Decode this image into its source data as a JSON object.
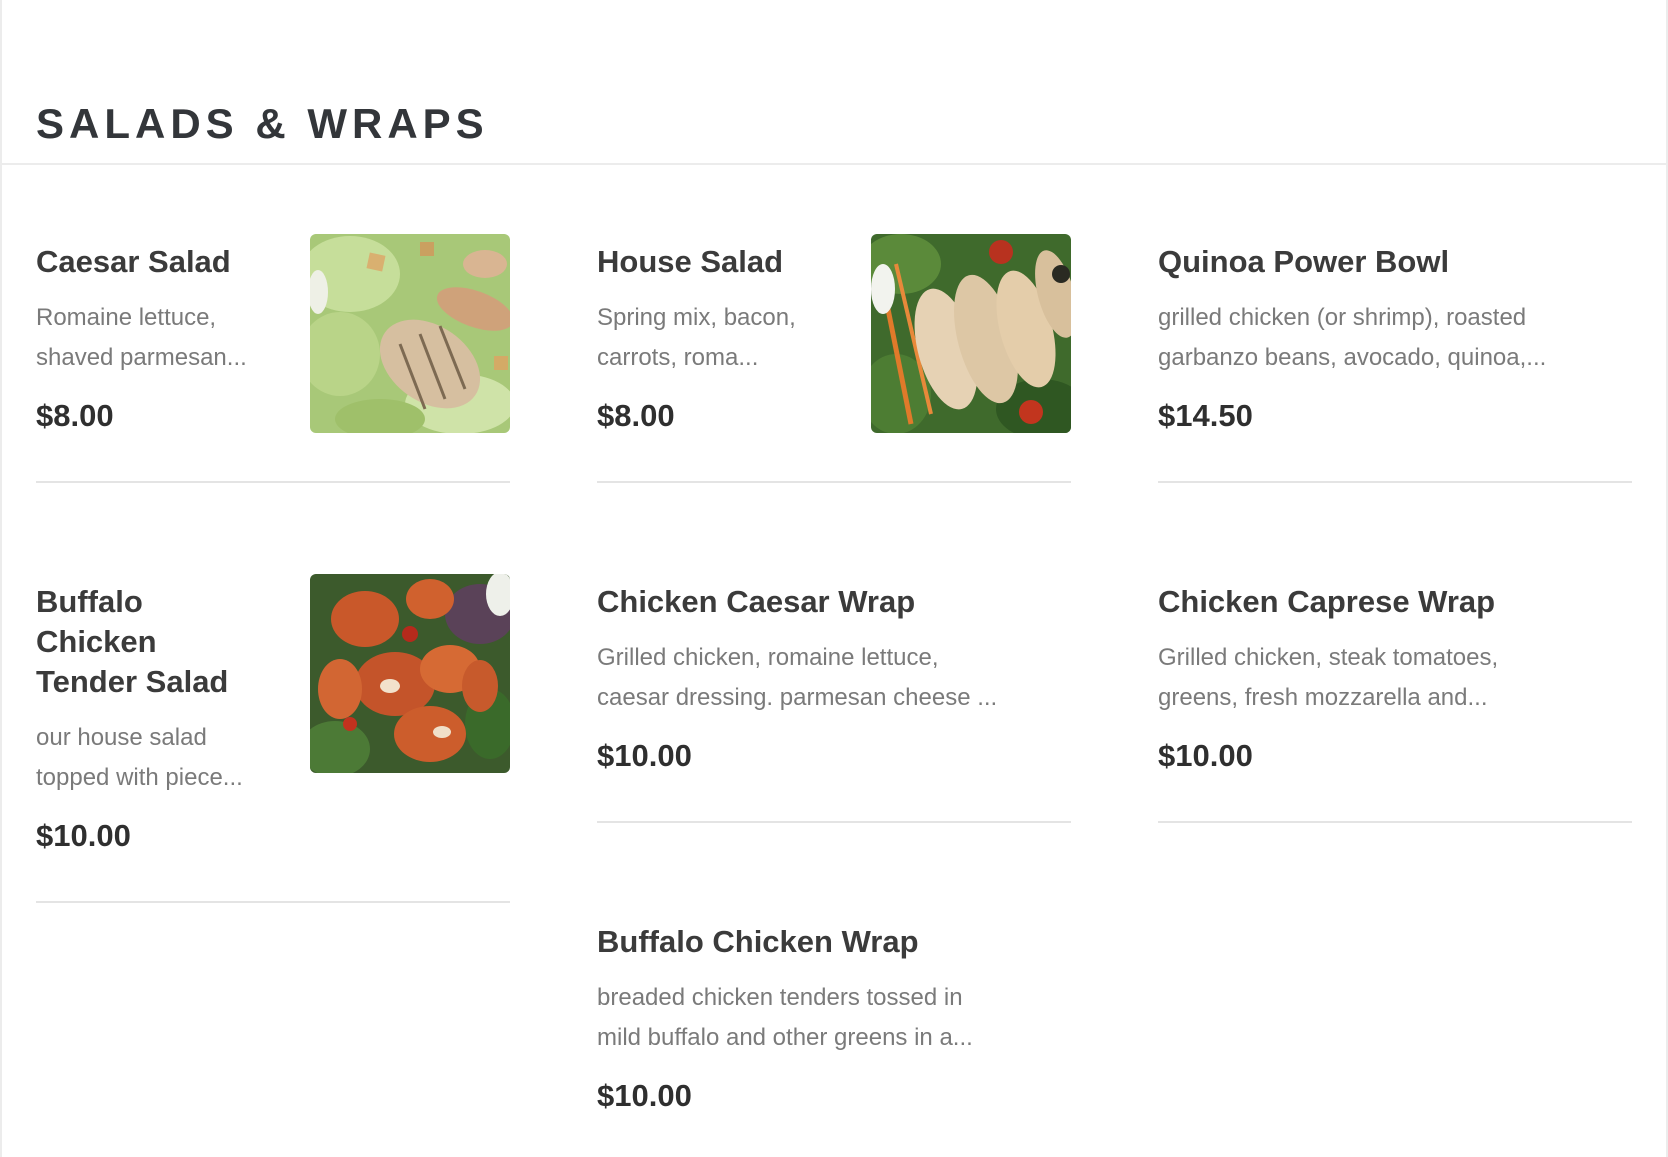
{
  "section": {
    "title": "SALADS & WRAPS"
  },
  "items": [
    {
      "name": "Caesar Salad",
      "desc_line1": "Romaine lettuce,",
      "desc_line2": "shaved parmesan...",
      "price": "$8.00",
      "image": "caesar-salad-photo"
    },
    {
      "name": "House Salad",
      "desc_line1": "Spring mix, bacon,",
      "desc_line2": "carrots, roma...",
      "price": "$8.00",
      "image": "house-salad-photo"
    },
    {
      "name": "Quinoa Power Bowl",
      "desc_line1": "grilled chicken (or shrimp), roasted",
      "desc_line2": "garbanzo beans, avocado, quinoa,...",
      "price": "$14.50"
    },
    {
      "name_line1": "Buffalo",
      "name_line2": "Chicken",
      "name_line3": "Tender Salad",
      "desc_line1": "our house salad",
      "desc_line2": "topped with piece...",
      "price": "$10.00",
      "image": "buffalo-salad-photo"
    },
    {
      "name": "Chicken Caesar Wrap",
      "desc_line1": "Grilled chicken, romaine lettuce,",
      "desc_line2": "caesar dressing. parmesan cheese ...",
      "price": "$10.00"
    },
    {
      "name": "Chicken Caprese Wrap",
      "desc_line1": "Grilled chicken, steak tomatoes,",
      "desc_line2": "greens, fresh mozzarella and...",
      "price": "$10.00"
    },
    {
      "name": "Buffalo Chicken Wrap",
      "desc_line1": "breaded chicken tenders tossed in",
      "desc_line2": "mild buffalo and other greens in a...",
      "price": "$10.00"
    }
  ],
  "colors": {
    "text_dark": "#3b3b3b",
    "text_muted": "#7a7a7a",
    "divider": "#e4e4e4"
  }
}
